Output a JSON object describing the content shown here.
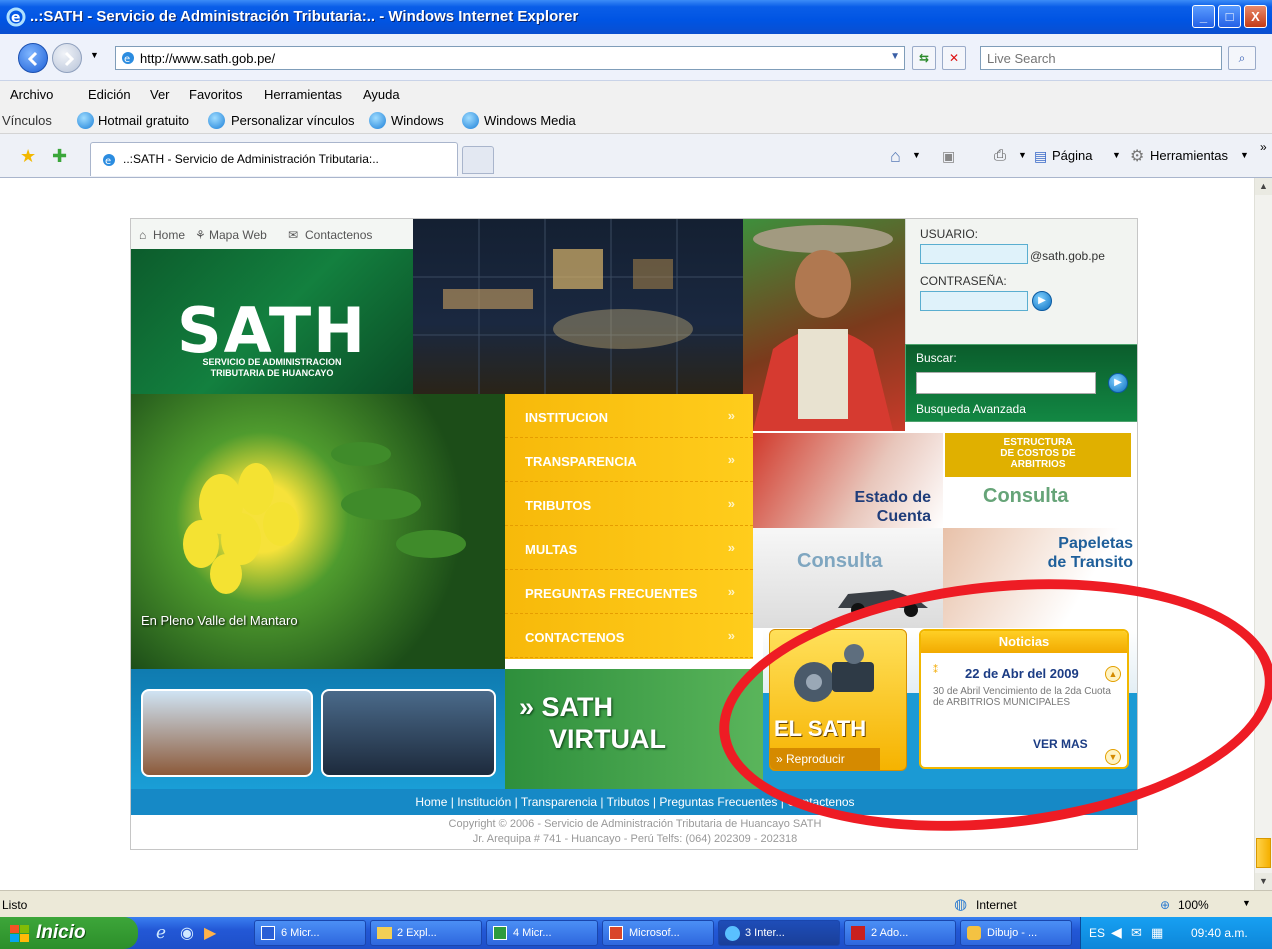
{
  "window": {
    "title": "..:SATH - Servicio de Administración Tributaria:.. - Windows Internet Explorer",
    "minimize": "_",
    "maximize": "□",
    "close": "X"
  },
  "address": {
    "url": "http://www.sath.gob.pe/",
    "search_placeholder": "Live Search"
  },
  "menu": [
    "Archivo",
    "Edición",
    "Ver",
    "Favoritos",
    "Herramientas",
    "Ayuda"
  ],
  "links": {
    "label": "Vínculos",
    "items": [
      "Hotmail gratuito",
      "Personalizar vínculos",
      "Windows",
      "Windows Media"
    ]
  },
  "tab": {
    "title": "..:SATH - Servicio de Administración Tributaria:..",
    "pagina": "Página",
    "herramientas": "Herramientas"
  },
  "site": {
    "topnav": [
      "Home",
      "Mapa Web",
      "Contactenos"
    ],
    "logo": "SATH",
    "logo_sub": [
      "SERVICIO DE ADMINISTRACION",
      "TRIBUTARIA DE HUANCAYO"
    ],
    "login": {
      "user_label": "USUARIO:",
      "user_suffix": "@sath.gob.pe",
      "pass_label": "CONTRASEÑA:"
    },
    "search": {
      "label": "Buscar:",
      "advanced": "Busqueda Avanzada"
    },
    "photo_caption": "En Pleno Valle del Mantaro",
    "menu_items": [
      "INSTITUCION",
      "TRANSPARENCIA",
      "TRIBUTOS",
      "MULTAS",
      "PREGUNTAS FRECUENTES",
      "CONTACTENOS"
    ],
    "tiles": {
      "estado": [
        "Estado de",
        "Cuenta"
      ],
      "estructura": [
        "ESTRUCTURA",
        "DE COSTOS DE",
        "ARBITRIOS"
      ],
      "estructura_consulta": "Consulta",
      "consulta": "Consulta",
      "papeletas": [
        "Papeletas",
        "de Transito"
      ]
    },
    "virtual": [
      "» SATH",
      "VIRTUAL"
    ],
    "elsath": {
      "title": "EL SATH",
      "play": "» Reproducir"
    },
    "noticias": {
      "header": "Noticias",
      "date": "22 de Abr del 2009",
      "body": "30 de Abril Vencimiento de la 2da Cuota de ARBITRIOS MUNICIPALES",
      "more": "VER MAS"
    },
    "footer_nav": "Home  |  Institución  |  Transparencia  |  Tributos  |  Preguntas Frecuentes  |  Contactenos",
    "copyright": "Copyright © 2006 - Servicio de Administración Tributaria de Huancayo SATH",
    "address": "Jr. Arequipa # 741 - Huancayo - Perú Telfs: (064) 202309 - 202318"
  },
  "status": {
    "text": "Listo",
    "zone": "Internet",
    "zoom": "100%"
  },
  "taskbar": {
    "start": "Inicio",
    "buttons": [
      "6 Micr...",
      "2 Expl...",
      "4 Micr...",
      "Microsof...",
      "3 Inter...",
      "2 Ado...",
      "Dibujo - ..."
    ],
    "lang": "ES",
    "clock": "09:40 a.m."
  },
  "colors": {
    "highlight_ring": "#ee1c24",
    "sath_green": "#13803f",
    "sath_yellow": "#f7b90a",
    "sath_blue": "#1689c6"
  }
}
